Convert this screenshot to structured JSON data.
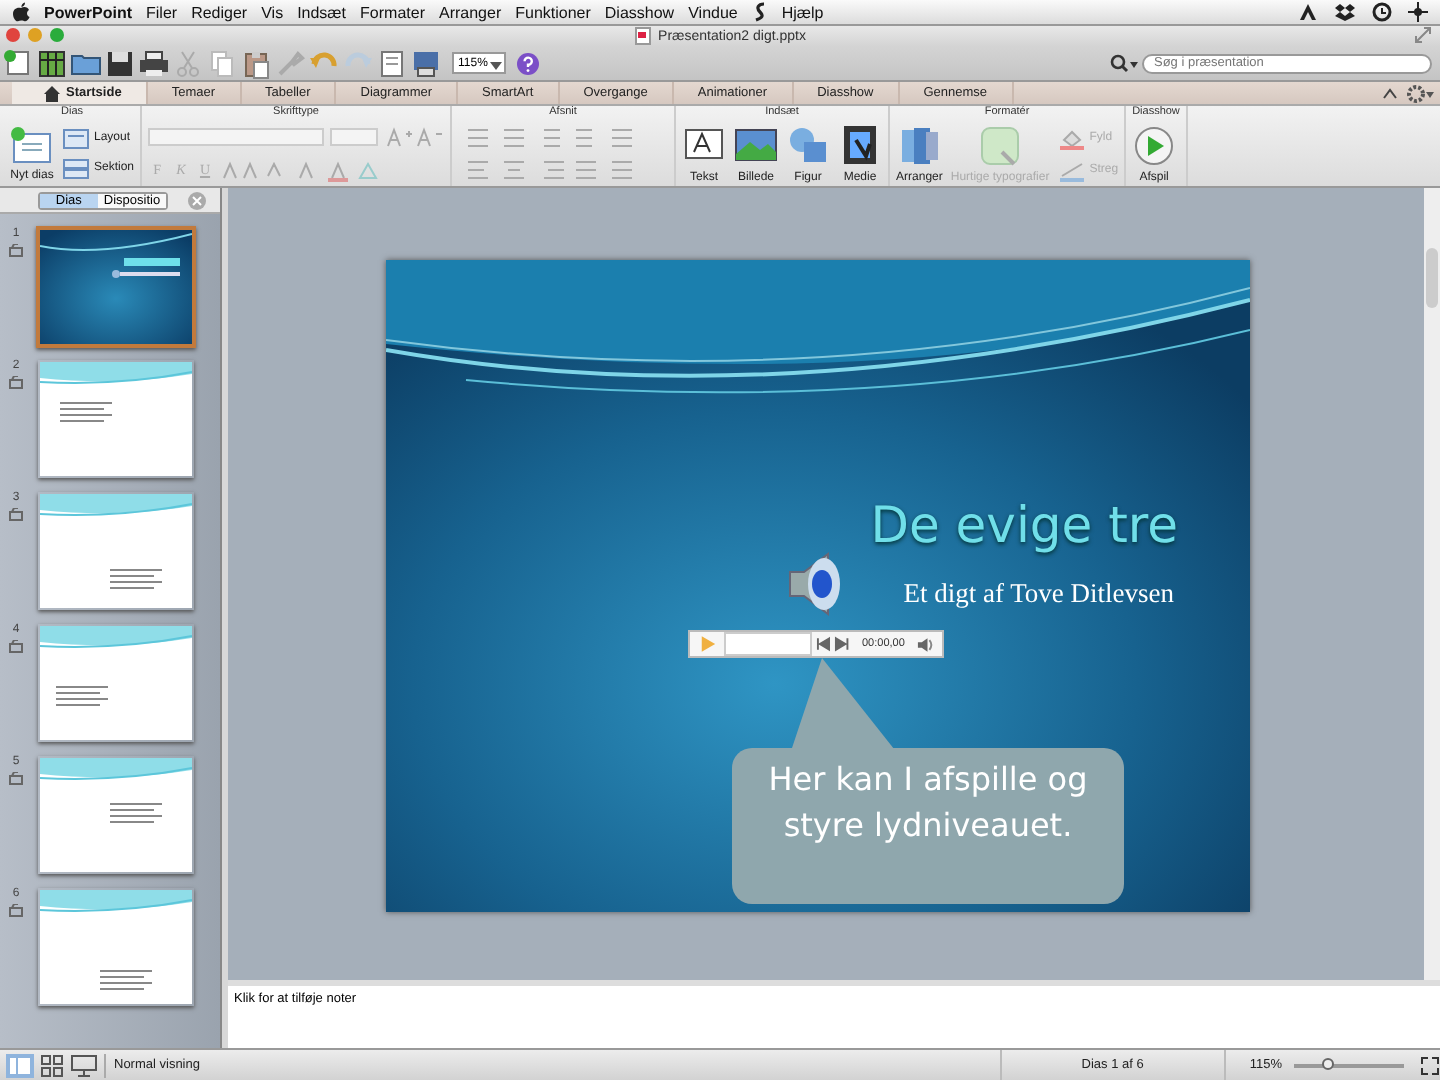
{
  "menu_bar": {
    "app": "PowerPoint",
    "items": [
      "Filer",
      "Rediger",
      "Vis",
      "Indsæt",
      "Formater",
      "Arranger",
      "Funktioner",
      "Diasshow",
      "Vindue"
    ],
    "help": "Hjælp"
  },
  "window": {
    "title": "Præsentation2 digt.pptx"
  },
  "toolbar": {
    "zoom": "115%",
    "search": {
      "placeholder": "Søg i præsentation"
    }
  },
  "ribbon_tabs": [
    {
      "label": "Startside",
      "selected": true
    },
    {
      "label": "Temaer",
      "selected": false
    },
    {
      "label": "Tabeller",
      "selected": false
    },
    {
      "label": "Diagrammer",
      "selected": false
    },
    {
      "label": "SmartArt",
      "selected": false
    },
    {
      "label": "Overgange",
      "selected": false
    },
    {
      "label": "Animationer",
      "selected": false
    },
    {
      "label": "Diasshow",
      "selected": false
    },
    {
      "label": "Gennemse",
      "selected": false
    }
  ],
  "ribbon_groups": [
    {
      "title": "Dias",
      "kind": "slides",
      "buttons": [
        {
          "label": "Nyt dias",
          "disabled": false
        },
        {
          "label": "Layout",
          "disabled": false
        },
        {
          "label": "Sektion",
          "disabled": false
        }
      ]
    },
    {
      "title": "Skrifttype",
      "kind": "font",
      "buttons": [
        {
          "label": "F",
          "disabled": true
        },
        {
          "label": "K",
          "disabled": true
        },
        {
          "label": "U",
          "disabled": true
        }
      ]
    },
    {
      "title": "Afsnit",
      "kind": "paragraph"
    },
    {
      "title": "Indsæt",
      "kind": "large",
      "buttons": [
        {
          "label": "Tekst",
          "disabled": false
        },
        {
          "label": "Billede",
          "disabled": false
        },
        {
          "label": "Figur",
          "disabled": false
        },
        {
          "label": "Medie",
          "disabled": false
        }
      ]
    },
    {
      "title": "Formatér",
      "kind": "format",
      "buttons": [
        {
          "label": "Arranger",
          "disabled": false
        },
        {
          "label": "Hurtige typografier",
          "disabled": true
        },
        {
          "label": "Fyld",
          "disabled": true
        },
        {
          "label": "Streg",
          "disabled": true
        }
      ]
    },
    {
      "title": "Diasshow",
      "kind": "large",
      "buttons": [
        {
          "label": "Afspil",
          "disabled": false
        }
      ]
    }
  ],
  "pane_tabs": [
    {
      "label": "Dias",
      "selected": true
    },
    {
      "label": "Dispositio",
      "selected": false
    }
  ],
  "thumbnails": [
    {
      "number": "1",
      "kind": "title",
      "selected": true
    },
    {
      "number": "2",
      "kind": "text",
      "selected": false
    },
    {
      "number": "3",
      "kind": "text",
      "selected": false
    },
    {
      "number": "4",
      "kind": "text",
      "selected": false
    },
    {
      "number": "5",
      "kind": "text",
      "selected": false
    },
    {
      "number": "6",
      "kind": "text",
      "selected": false
    }
  ],
  "slide": {
    "title": "De evige tre",
    "subtitle": "Et digt af Tove Ditlevsen",
    "player": {
      "time": "00:00,00"
    },
    "callout": "Her kan I afspille og styre lydniveauet."
  },
  "notes": {
    "placeholder": "Klik for at tilføje noter"
  },
  "status_bar": {
    "view": "Normal visning",
    "slide_count": "Dias 1 af 6",
    "zoom": "115%",
    "zoom_slider": {
      "level": 0.3
    }
  }
}
